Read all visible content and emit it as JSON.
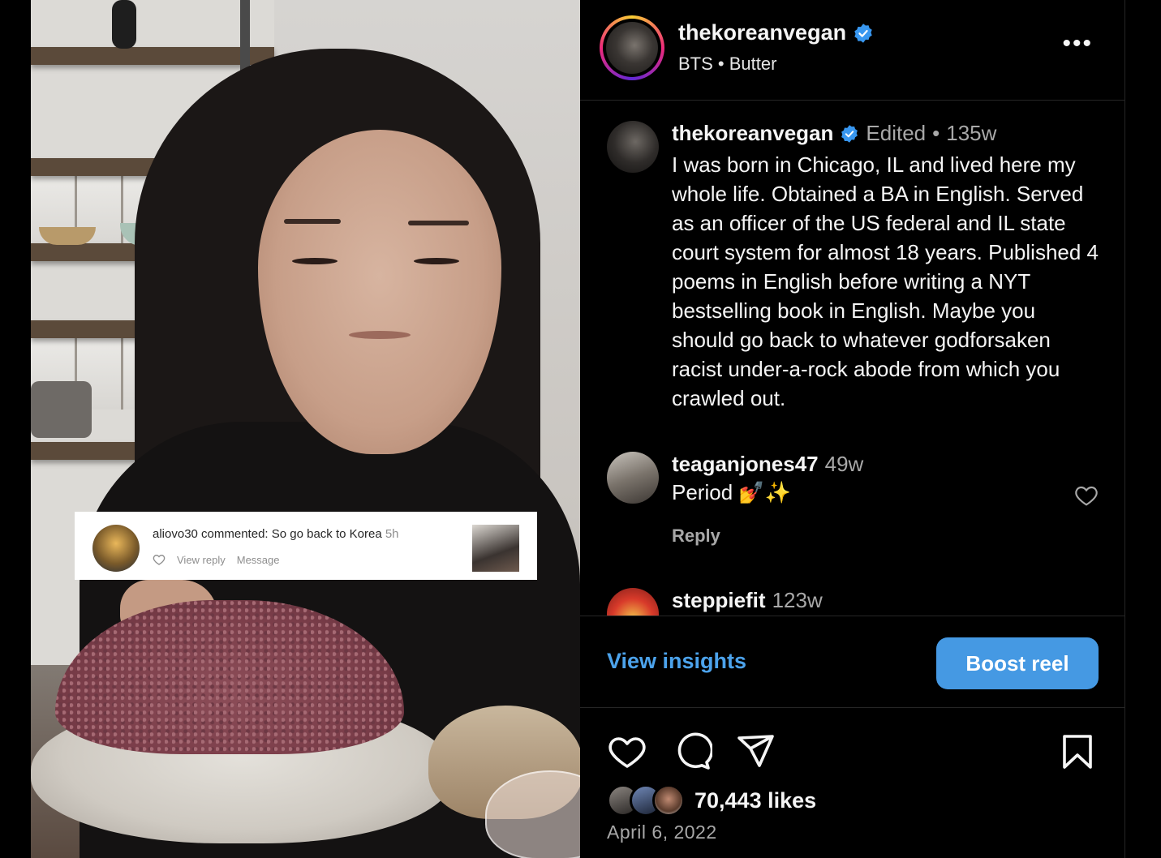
{
  "sticker": {
    "text": "aliovo30 commented: So go back to Korea",
    "time": "5h",
    "view_reply": "View reply",
    "message": "Message"
  },
  "header": {
    "username": "thekoreanvegan",
    "audio": "BTS • Butter",
    "more_label": "•••"
  },
  "caption": {
    "username": "thekoreanvegan",
    "edited": "Edited",
    "sep": "•",
    "time": "135w",
    "text": "I was born in Chicago, IL and lived here my whole life. Obtained a BA in English. Served as an officer of the US federal and IL state court system for almost 18 years. Published 4 poems in English before writing a NYT bestselling book in English. Maybe you should go back to whatever godforsaken racist under-a-rock abode from which you crawled out."
  },
  "comments": [
    {
      "username": "teaganjones47",
      "time": "49w",
      "text": "Period 💅✨",
      "reply_label": "Reply"
    },
    {
      "username": "steppiefit",
      "time": "123w"
    }
  ],
  "actions": {
    "view_insights": "View insights",
    "boost": "Boost reel"
  },
  "stats": {
    "likes": "70,443 likes",
    "date": "April 6, 2022"
  },
  "colors": {
    "verified": "#3897f0",
    "link": "#4ca3ec",
    "boost": "#4599e3"
  }
}
